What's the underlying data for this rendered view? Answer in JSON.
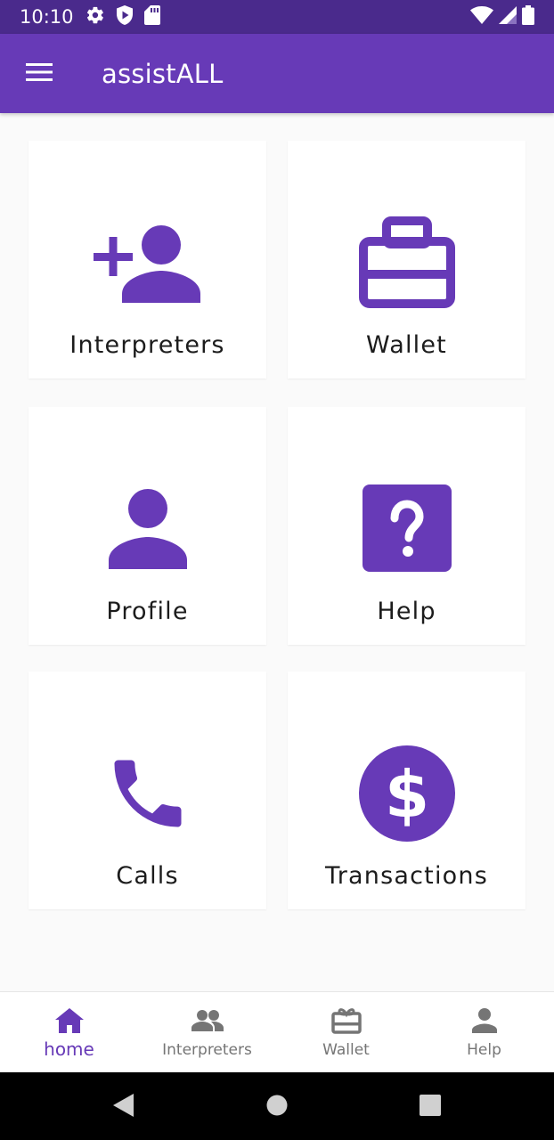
{
  "status_bar": {
    "time": "10:10",
    "left_icons": [
      "settings-icon",
      "shield-play-icon",
      "sd-card-icon"
    ],
    "right_icons": [
      "wifi-icon",
      "signal-icon",
      "battery-icon"
    ]
  },
  "app_bar": {
    "title": "assistALL",
    "menu_icon": "hamburger-menu-icon"
  },
  "colors": {
    "primary": "#673ab7",
    "status_bar": "#4a2a8c",
    "background": "#fafafa",
    "tile_background": "#ffffff",
    "inactive_nav": "#757575"
  },
  "tiles": [
    {
      "label": "Interpreters",
      "icon": "add-person-icon"
    },
    {
      "label": "Wallet",
      "icon": "briefcase-icon"
    },
    {
      "label": "Profile",
      "icon": "person-icon"
    },
    {
      "label": "Help",
      "icon": "help-icon"
    },
    {
      "label": "Calls",
      "icon": "phone-icon"
    },
    {
      "label": "Transactions",
      "icon": "dollar-icon"
    }
  ],
  "bottom_nav": [
    {
      "label": "home",
      "icon": "home-icon",
      "active": true
    },
    {
      "label": "Interpreters",
      "icon": "people-icon",
      "active": false
    },
    {
      "label": "Wallet",
      "icon": "gift-card-icon",
      "active": false
    },
    {
      "label": "Help",
      "icon": "person-icon",
      "active": false
    }
  ],
  "system_nav": [
    "back-icon",
    "home-circle-icon",
    "recents-icon"
  ]
}
